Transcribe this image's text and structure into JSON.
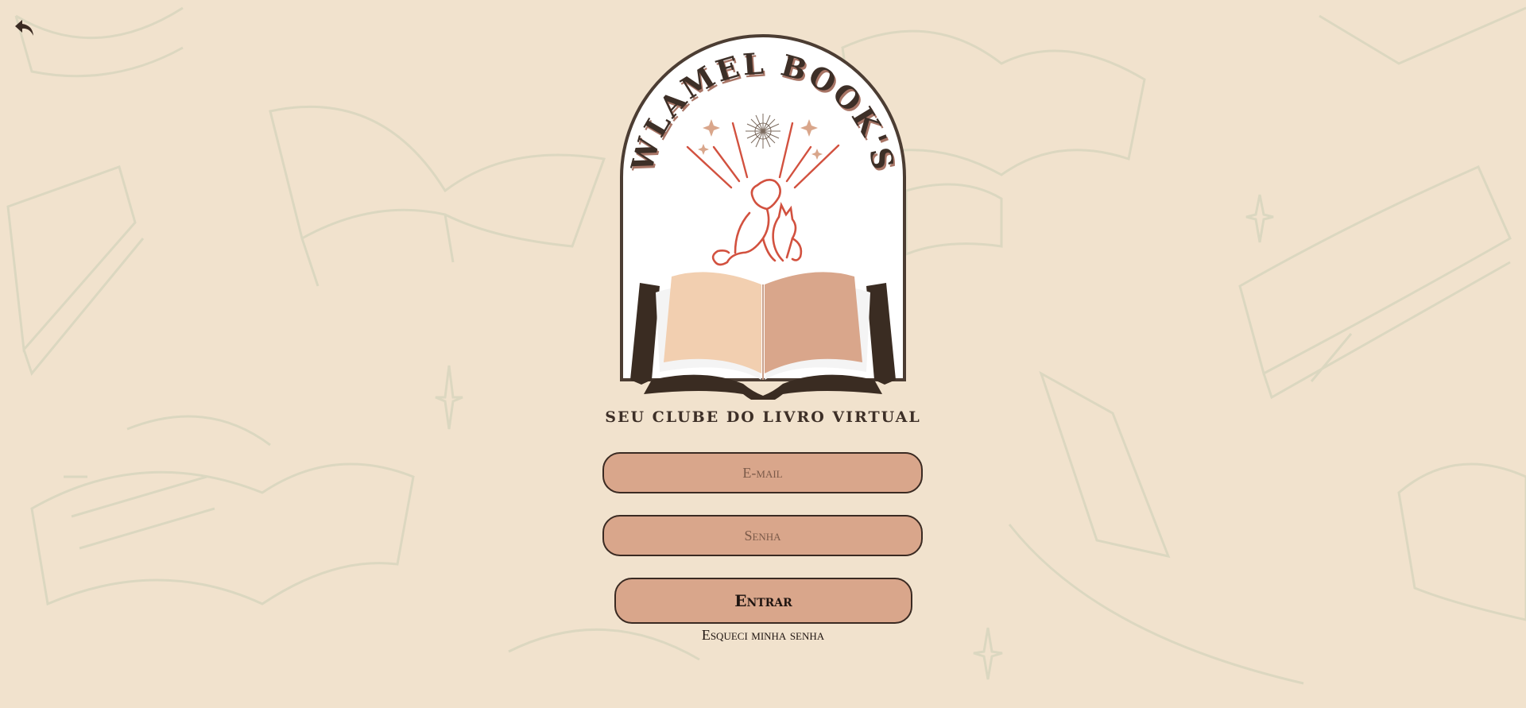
{
  "brand": {
    "name": "WLAMEL BOOK'S",
    "tagline": "SEU CLUBE DO LIVRO VIRTUAL"
  },
  "form": {
    "email_placeholder": "E-mail",
    "password_placeholder": "Senha",
    "submit_label": "Entrar",
    "forgot_label": "Esqueci minha senha"
  },
  "icons": {
    "back": "back-arrow-icon"
  },
  "colors": {
    "background": "#f1e2cd",
    "field_fill": "#d9a68b",
    "border": "#3a2a22",
    "accent_red": "#d2513f"
  }
}
